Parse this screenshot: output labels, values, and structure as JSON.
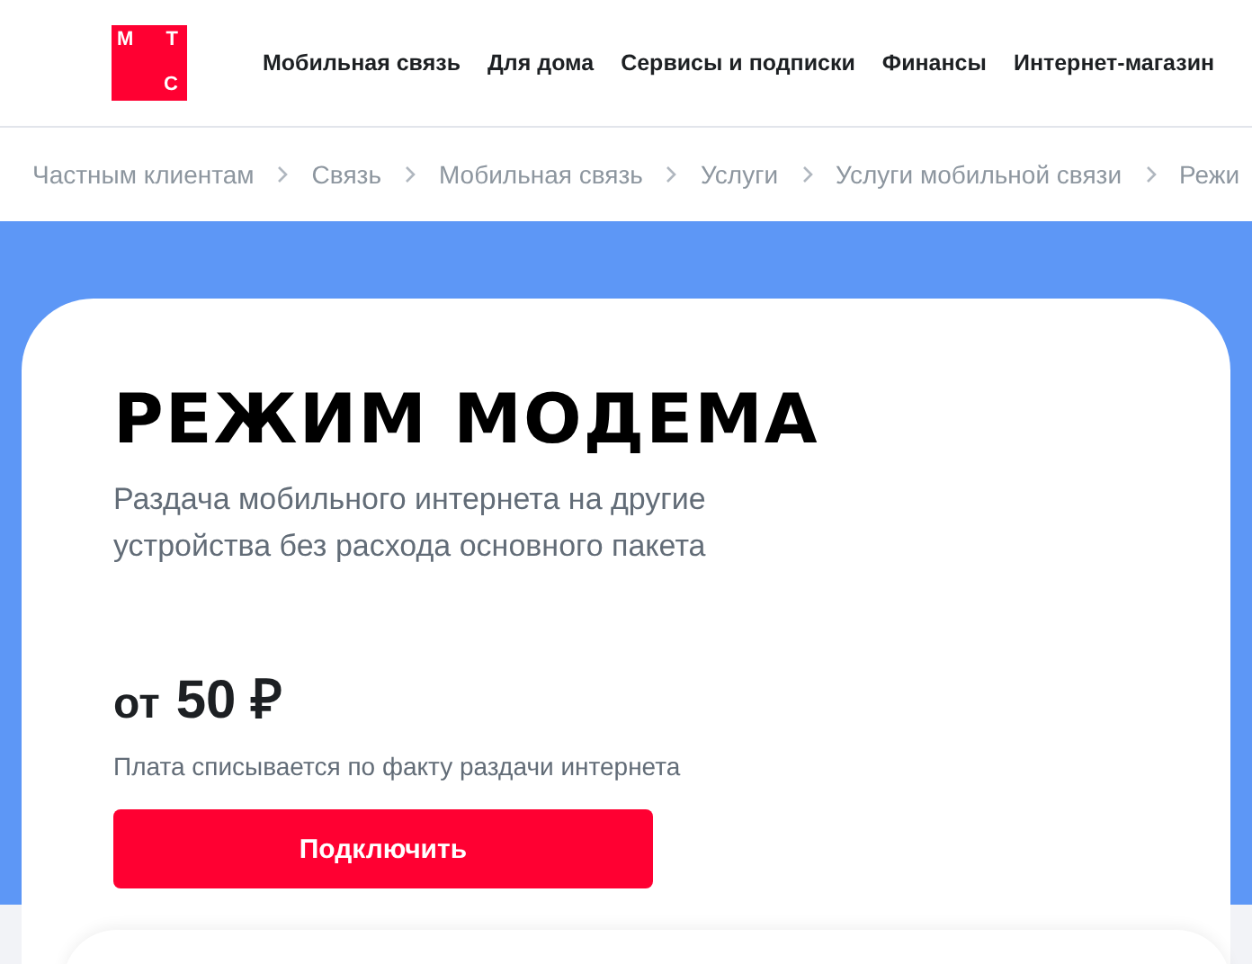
{
  "logo": {
    "letters": [
      "М",
      "Т",
      "С"
    ]
  },
  "nav": [
    {
      "label": "Мобильная связь"
    },
    {
      "label": "Для дома"
    },
    {
      "label": "Сервисы и подписки"
    },
    {
      "label": "Финансы"
    },
    {
      "label": "Интернет-магазин"
    }
  ],
  "breadcrumbs": [
    "Частным клиентам",
    "Связь",
    "Мобильная связь",
    "Услуги",
    "Услуги мобильной связи",
    "Режи"
  ],
  "hero": {
    "title": "РЕЖИМ МОДЕМА",
    "subtitle": "Раздача мобильного интернета на другие устройства без расхода основного пакета",
    "price_prefix": "от",
    "price": "50 ₽",
    "price_note": "Плата списывается по факту раздачи интернета",
    "button": "Подключить"
  }
}
